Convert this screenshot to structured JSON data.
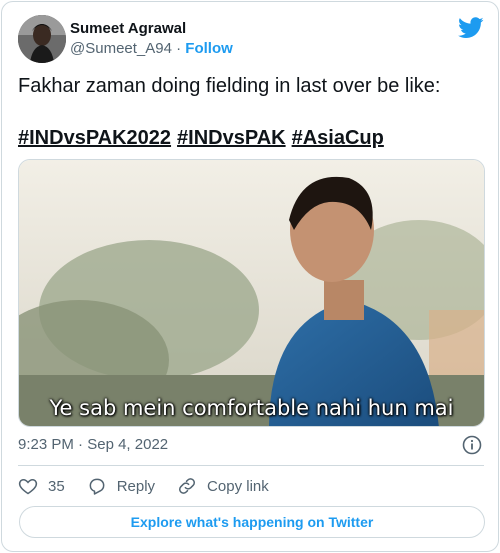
{
  "author": {
    "display_name": "Sumeet Agrawal",
    "handle": "@Sumeet_A94",
    "separator": "·",
    "follow_label": "Follow"
  },
  "tweet": {
    "text": "Fakhar zaman doing fielding in last over be like:",
    "hashtags": [
      "#INDvsPAK2022",
      "#INDvsPAK",
      "#AsiaCup"
    ]
  },
  "media": {
    "caption": "Ye sab mein comfortable nahi hun mai"
  },
  "meta": {
    "time": "9:23 PM",
    "separator": "·",
    "date": "Sep 4, 2022",
    "info_icon": "info-icon"
  },
  "actions": {
    "like_count": "35",
    "reply_label": "Reply",
    "copy_label": "Copy link"
  },
  "explore_label": "Explore what's happening on Twitter",
  "colors": {
    "accent": "#1d9bf0",
    "text": "#0f1419",
    "muted": "#536471",
    "border": "#cfd9de"
  },
  "icons": {
    "logo": "twitter-bird-icon",
    "like": "heart-icon",
    "reply": "reply-bubble-icon",
    "copy": "link-icon"
  }
}
